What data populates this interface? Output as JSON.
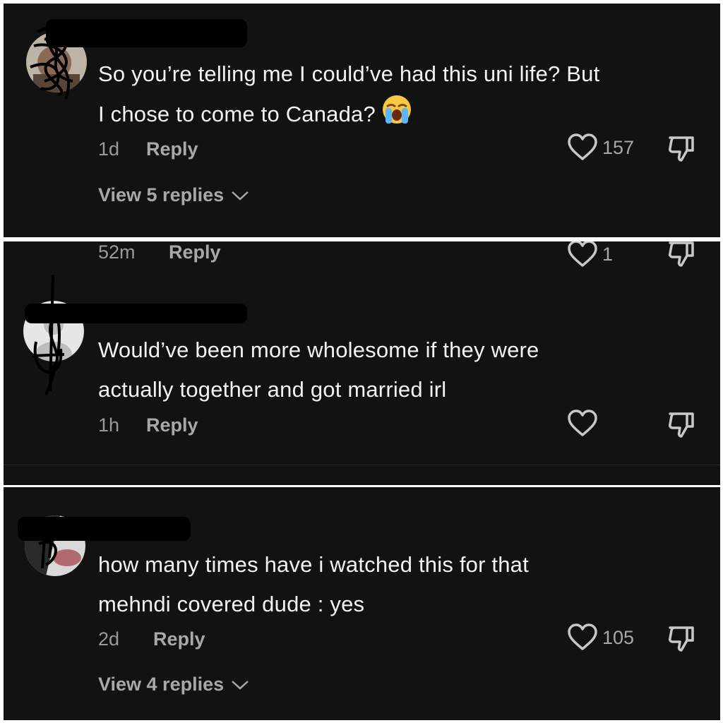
{
  "comments": [
    {
      "text_line1": "So you’re telling me I could’ve had this uni life? But",
      "text_line2": "I chose to come to Canada?",
      "emoji": "loudly-crying-face",
      "time": "1d",
      "reply": "Reply",
      "likes": "157",
      "view_replies": "View 5 replies"
    },
    {
      "time": "52m",
      "reply": "Reply",
      "likes": "1"
    },
    {
      "text_line1": "Would’ve been more wholesome if they were",
      "text_line2": "actually together and got married irl",
      "time": "1h",
      "reply": "Reply"
    },
    {
      "text_line1": "how many times have i watched this for that",
      "text_line2": "mehndi covered dude : yes",
      "time": "2d",
      "reply": "Reply",
      "likes": "105",
      "view_replies": "View 4 replies"
    }
  ],
  "icons": {
    "like": "heart-outline-icon",
    "dislike": "thumbs-down-icon",
    "expand": "chevron-down-icon"
  },
  "colors": {
    "background": "#121212",
    "text": "#f2f2f2",
    "meta": "#9a9a9a"
  }
}
